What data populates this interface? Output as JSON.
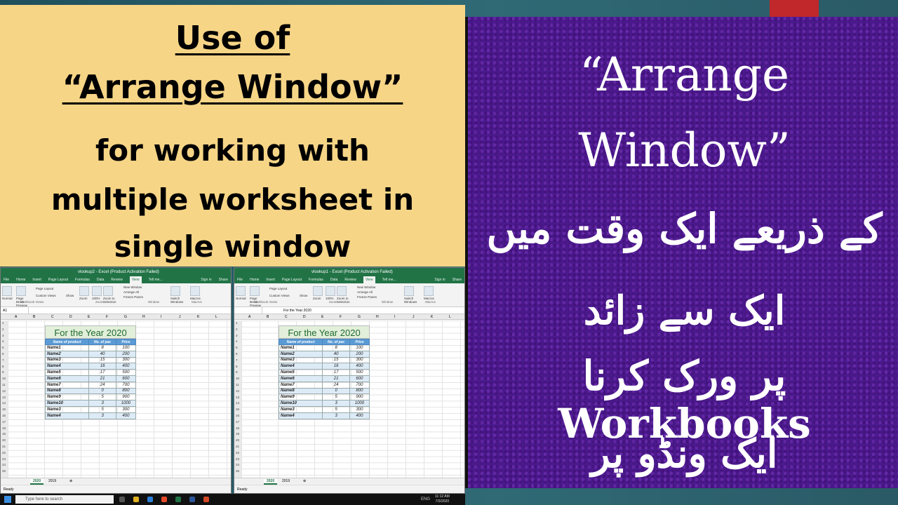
{
  "title_card": {
    "line1": "Use of",
    "line2": "“Arrange Window”",
    "line3": "for working with",
    "line4": "multiple worksheet in",
    "line5": "single window"
  },
  "right_panel": {
    "line1": "“Arrange",
    "line2": "Window”",
    "urdu1": "کے ذریعے ایک وقت میں",
    "urdu2": "ایک سے زائد",
    "urdu3": "پر ورک کرنا Workbooks",
    "urdu4": "ایک ونڈو پر"
  },
  "excel_left": {
    "window_title": "vlookup2 - Excel (Product Activation Failed)",
    "tabs": [
      "File",
      "Home",
      "Insert",
      "Page Layout",
      "Formulas",
      "Data",
      "Review",
      "View",
      "Tell me..."
    ],
    "active_tab": "View",
    "name_box": "A1",
    "sheet_active": "2020",
    "sheet_other": "2019",
    "status": "Ready"
  },
  "excel_right": {
    "window_title": "vlookup1 - Excel (Product Activation Failed)",
    "tabs": [
      "File",
      "Home",
      "Insert",
      "Page Layout",
      "Formulas",
      "Data",
      "Review",
      "View",
      "Tell me..."
    ],
    "active_tab": "View",
    "name_box": "",
    "formula_text": "For the Year 2020",
    "sheet_active": "2020",
    "sheet_other": "2019",
    "status": "Ready"
  },
  "ribbon": {
    "normal": "Normal",
    "page_break": "Page Break Preview",
    "page_layout": "Page Layout",
    "custom_views": "Custom Views",
    "group_workbook_views": "Workbook Views",
    "show": "Show",
    "zoom": "Zoom",
    "zoom100": "100%",
    "zoom_selection": "Zoom to Selection",
    "group_zoom": "Zoom",
    "new_window": "New Window",
    "arrange_all": "Arrange All",
    "freeze": "Freeze Panes",
    "switch": "Switch Windows",
    "group_window": "Window",
    "macros": "Macros",
    "group_macros": "Macros",
    "signin": "Sign in",
    "share": "Share"
  },
  "columns": [
    "A",
    "B",
    "C",
    "D",
    "E",
    "F",
    "G",
    "H",
    "I",
    "J",
    "K",
    "L",
    "M"
  ],
  "rows": [
    "1",
    "2",
    "3",
    "4",
    "5",
    "6",
    "7",
    "8",
    "9",
    "10",
    "11",
    "12",
    "13",
    "14",
    "15",
    "16",
    "17",
    "18",
    "19",
    "20",
    "21",
    "22",
    "23",
    "24",
    "25"
  ],
  "table": {
    "title": "For the Year 2020",
    "headers": [
      "Name of product",
      "No. of pac",
      "Price"
    ],
    "rows": [
      [
        "Name1",
        "8",
        "100"
      ],
      [
        "Name2",
        "40",
        "200"
      ],
      [
        "Name3",
        "15",
        "300"
      ],
      [
        "Name4",
        "16",
        "400"
      ],
      [
        "Name5",
        "17",
        "500"
      ],
      [
        "Name6",
        "21",
        "600"
      ],
      [
        "Name7",
        "24",
        "700"
      ],
      [
        "Name8",
        "0",
        "800"
      ],
      [
        "Name9",
        "5",
        "900"
      ],
      [
        "Name10",
        "3",
        "1000"
      ],
      [
        "Name3",
        "5",
        "300"
      ],
      [
        "Name4",
        "3",
        "400"
      ]
    ]
  },
  "taskbar": {
    "search_placeholder": "Type here to search",
    "lang": "ENG",
    "time": "11:12 AM",
    "date": "7/3/2020"
  },
  "colors": {
    "excel_green": "#217346",
    "title_card": "#f6d586",
    "purple": "#4a1a8c",
    "accent_red": "#c0282c"
  }
}
